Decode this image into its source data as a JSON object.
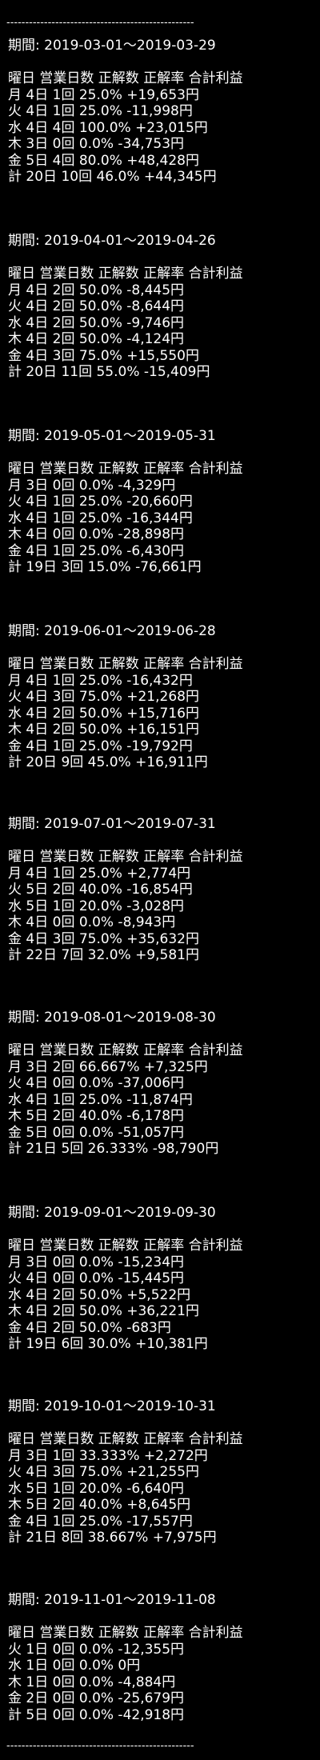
{
  "divider": "--------------------------------------------------",
  "period_label": "期間",
  "header": "曜日 営業日数 正解数 正解率 合計利益",
  "sections": [
    {
      "period": "2019-03-01～2019-03-29",
      "rows": [
        "月 4日 1回 25.0% +19,653円",
        "火 4日 1回 25.0% -11,998円",
        "水 4日 4回 100.0% +23,015円",
        "木 3日 0回 0.0% -34,753円",
        "金 5日 4回 80.0% +48,428円",
        "計 20日 10回 46.0% +44,345円"
      ]
    },
    {
      "period": "2019-04-01～2019-04-26",
      "rows": [
        "月 4日 2回 50.0% -8,445円",
        "火 4日 2回 50.0% -8,644円",
        "水 4日 2回 50.0% -9,746円",
        "木 4日 2回 50.0% -4,124円",
        "金 4日 3回 75.0% +15,550円",
        "計 20日 11回 55.0% -15,409円"
      ]
    },
    {
      "period": "2019-05-01～2019-05-31",
      "rows": [
        "月 3日 0回 0.0% -4,329円",
        "火 4日 1回 25.0% -20,660円",
        "水 4日 1回 25.0% -16,344円",
        "木 4日 0回 0.0% -28,898円",
        "金 4日 1回 25.0% -6,430円",
        "計 19日 3回 15.0% -76,661円"
      ]
    },
    {
      "period": "2019-06-01～2019-06-28",
      "rows": [
        "月 4日 1回 25.0% -16,432円",
        "火 4日 3回 75.0% +21,268円",
        "水 4日 2回 50.0% +15,716円",
        "木 4日 2回 50.0% +16,151円",
        "金 4日 1回 25.0% -19,792円",
        "計 20日 9回 45.0% +16,911円"
      ]
    },
    {
      "period": "2019-07-01～2019-07-31",
      "rows": [
        "月 4日 1回 25.0% +2,774円",
        "火 5日 2回 40.0% -16,854円",
        "水 5日 1回 20.0% -3,028円",
        "木 4日 0回 0.0% -8,943円",
        "金 4日 3回 75.0% +35,632円",
        "計 22日 7回 32.0% +9,581円"
      ]
    },
    {
      "period": "2019-08-01～2019-08-30",
      "rows": [
        "月 3日 2回 66.667% +7,325円",
        "火 4日 0回 0.0% -37,006円",
        "水 4日 1回 25.0% -11,874円",
        "木 5日 2回 40.0% -6,178円",
        "金 5日 0回 0.0% -51,057円",
        "計 21日 5回 26.333% -98,790円"
      ]
    },
    {
      "period": "2019-09-01～2019-09-30",
      "rows": [
        "月 3日 0回 0.0% -15,234円",
        "火 4日 0回 0.0% -15,445円",
        "水 4日 2回 50.0% +5,522円",
        "木 4日 2回 50.0% +36,221円",
        "金 4日 2回 50.0% -683円",
        "計 19日 6回 30.0% +10,381円"
      ]
    },
    {
      "period": "2019-10-01～2019-10-31",
      "rows": [
        "月 3日 1回 33.333% +2,272円",
        "火 4日 3回 75.0% +21,255円",
        "水 5日 1回 20.0% -6,640円",
        "木 5日 2回 40.0% +8,645円",
        "金 4日 1回 25.0% -17,557円",
        "計 21日 8回 38.667% +7,975円"
      ]
    },
    {
      "period": "2019-11-01～2019-11-08",
      "rows": [
        "火 1日 0回 0.0% -12,355円",
        "水 1日 0回 0.0% 0円",
        "木 1日 0回 0.0% -4,884円",
        "金 2日 0回 0.0% -25,679円",
        "計 5日 0回 0.0% -42,918円"
      ]
    }
  ]
}
